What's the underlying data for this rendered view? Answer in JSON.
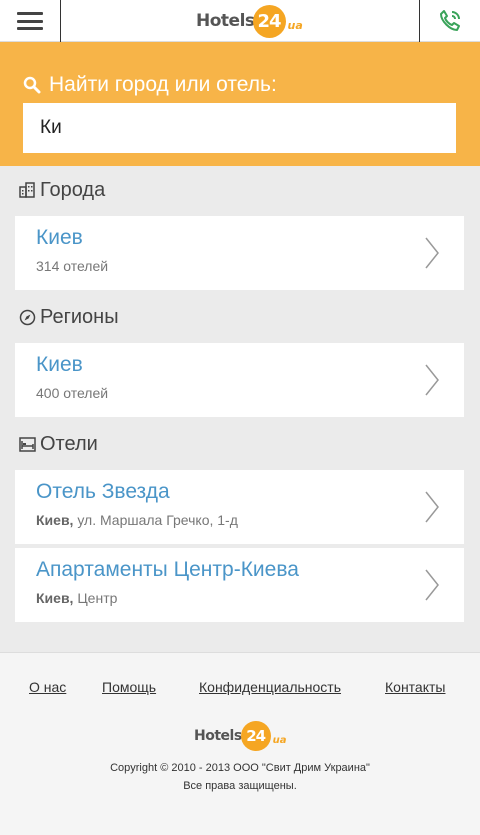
{
  "header": {
    "logo_text": "Hotels",
    "logo_num": "24",
    "logo_suffix": "ua"
  },
  "search": {
    "label": "Найти город или отель:",
    "value": "Ки"
  },
  "sections": {
    "cities": {
      "title": "Города",
      "items": [
        {
          "name": "Киев",
          "sub": "314 отелей"
        }
      ]
    },
    "regions": {
      "title": "Регионы",
      "items": [
        {
          "name": "Киев",
          "sub": "400 отелей"
        }
      ]
    },
    "hotels": {
      "title": "Отели",
      "items": [
        {
          "name": "Отель Звезда",
          "city": "Киев,",
          "address": "ул. Маршала Гречко, 1-д"
        },
        {
          "name": "Апартаменты Центр-Киева",
          "city": "Киев,",
          "address": "Центр"
        }
      ]
    }
  },
  "footer": {
    "links": {
      "about": "О нас",
      "help": "Помощь",
      "privacy": "Конфиденциальность",
      "contacts": "Контакты"
    },
    "logo_text": "Hotels",
    "logo_num": "24",
    "logo_suffix": "ua",
    "copyright": "Copyright © 2010 - 2013 ООО \"Свит Дрим Украина\"",
    "rights": "Все права защищены."
  },
  "colors": {
    "accent": "#f7b448",
    "link": "#4a95c8",
    "phone": "#3aa35a"
  },
  "icons": {
    "menu": "hamburger-icon",
    "phone": "phone-icon",
    "search": "search-icon",
    "cities": "building-icon",
    "regions": "compass-icon",
    "hotels": "bed-icon",
    "item": "chevron-right-icon"
  }
}
